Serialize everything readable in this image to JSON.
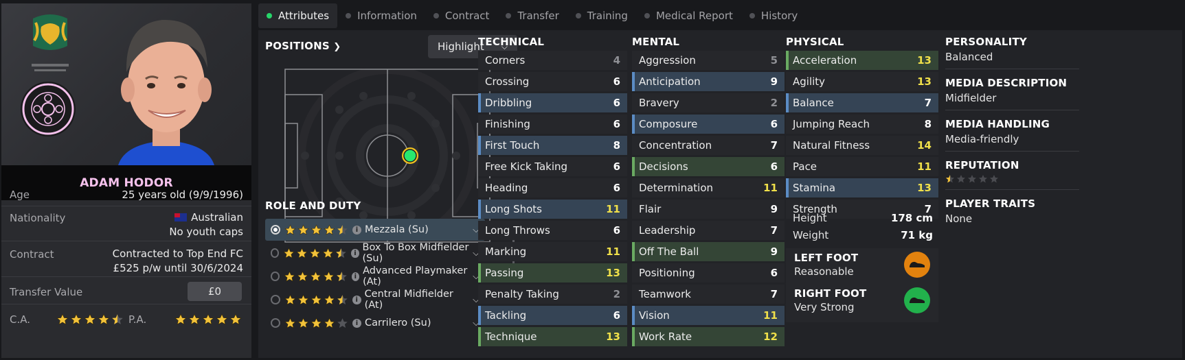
{
  "player": {
    "name": "ADAM HODOR",
    "age_label": "Age",
    "age": "25 years old (9/9/1996)",
    "nationality_label": "Nationality",
    "nationality": "Australian",
    "youth_caps": "No youth caps",
    "contract_label": "Contract",
    "contract_line1": "Contracted to Top End FC",
    "contract_line2": "£525 p/w until 30/6/2024",
    "transfer_label": "Transfer Value",
    "transfer_value": "£0",
    "ca_label": "C.A.",
    "pa_label": "P.A.",
    "ca_stars": 4.5,
    "pa_stars": 5
  },
  "tabs": [
    {
      "label": "Attributes",
      "active": true
    },
    {
      "label": "Information"
    },
    {
      "label": "Contract"
    },
    {
      "label": "Transfer"
    },
    {
      "label": "Training"
    },
    {
      "label": "Medical Report"
    },
    {
      "label": "History"
    }
  ],
  "positions": {
    "title": "POSITIONS",
    "highlight_label": "Highlight"
  },
  "role_duty": {
    "title": "ROLE AND DUTY",
    "roles": [
      {
        "label": "Mezzala (Su)",
        "stars": 4.5,
        "selected": true
      },
      {
        "label": "Box To Box Midfielder (Su)",
        "stars": 4.5
      },
      {
        "label": "Advanced Playmaker (At)",
        "stars": 4.5
      },
      {
        "label": "Central Midfielder (At)",
        "stars": 4.5
      },
      {
        "label": "Carrilero (Su)",
        "stars": 4
      }
    ]
  },
  "technical": {
    "title": "TECHNICAL",
    "rows": [
      {
        "name": "Corners",
        "value": "4",
        "hl": "",
        "tone": "g"
      },
      {
        "name": "Crossing",
        "value": "6",
        "hl": "",
        "tone": "w"
      },
      {
        "name": "Dribbling",
        "value": "6",
        "hl": "blue",
        "tone": "w"
      },
      {
        "name": "Finishing",
        "value": "6",
        "hl": "",
        "tone": "w"
      },
      {
        "name": "First Touch",
        "value": "8",
        "hl": "blue",
        "tone": "w"
      },
      {
        "name": "Free Kick Taking",
        "value": "6",
        "hl": "",
        "tone": "w"
      },
      {
        "name": "Heading",
        "value": "6",
        "hl": "",
        "tone": "w"
      },
      {
        "name": "Long Shots",
        "value": "11",
        "hl": "blue",
        "tone": "y"
      },
      {
        "name": "Long Throws",
        "value": "6",
        "hl": "",
        "tone": "w"
      },
      {
        "name": "Marking",
        "value": "11",
        "hl": "",
        "tone": "y"
      },
      {
        "name": "Passing",
        "value": "13",
        "hl": "green",
        "tone": "y"
      },
      {
        "name": "Penalty Taking",
        "value": "2",
        "hl": "",
        "tone": "g"
      },
      {
        "name": "Tackling",
        "value": "6",
        "hl": "blue",
        "tone": "w"
      },
      {
        "name": "Technique",
        "value": "13",
        "hl": "green",
        "tone": "y"
      }
    ]
  },
  "mental": {
    "title": "MENTAL",
    "rows": [
      {
        "name": "Aggression",
        "value": "5",
        "hl": "",
        "tone": "g"
      },
      {
        "name": "Anticipation",
        "value": "9",
        "hl": "blue",
        "tone": "w"
      },
      {
        "name": "Bravery",
        "value": "2",
        "hl": "",
        "tone": "g"
      },
      {
        "name": "Composure",
        "value": "6",
        "hl": "blue",
        "tone": "w"
      },
      {
        "name": "Concentration",
        "value": "7",
        "hl": "",
        "tone": "w"
      },
      {
        "name": "Decisions",
        "value": "6",
        "hl": "green",
        "tone": "w"
      },
      {
        "name": "Determination",
        "value": "11",
        "hl": "",
        "tone": "y"
      },
      {
        "name": "Flair",
        "value": "9",
        "hl": "",
        "tone": "w"
      },
      {
        "name": "Leadership",
        "value": "7",
        "hl": "",
        "tone": "w"
      },
      {
        "name": "Off The Ball",
        "value": "9",
        "hl": "green",
        "tone": "w"
      },
      {
        "name": "Positioning",
        "value": "6",
        "hl": "",
        "tone": "w"
      },
      {
        "name": "Teamwork",
        "value": "7",
        "hl": "",
        "tone": "w"
      },
      {
        "name": "Vision",
        "value": "11",
        "hl": "blue",
        "tone": "y"
      },
      {
        "name": "Work Rate",
        "value": "12",
        "hl": "green",
        "tone": "y"
      }
    ]
  },
  "physical": {
    "title": "PHYSICAL",
    "rows": [
      {
        "name": "Acceleration",
        "value": "13",
        "hl": "green",
        "tone": "y"
      },
      {
        "name": "Agility",
        "value": "13",
        "hl": "",
        "tone": "y"
      },
      {
        "name": "Balance",
        "value": "7",
        "hl": "blue",
        "tone": "w"
      },
      {
        "name": "Jumping Reach",
        "value": "8",
        "hl": "",
        "tone": "w"
      },
      {
        "name": "Natural Fitness",
        "value": "14",
        "hl": "",
        "tone": "y"
      },
      {
        "name": "Pace",
        "value": "11",
        "hl": "",
        "tone": "y"
      },
      {
        "name": "Stamina",
        "value": "13",
        "hl": "blue",
        "tone": "y"
      },
      {
        "name": "Strength",
        "value": "7",
        "hl": "",
        "tone": "w"
      }
    ],
    "height_label": "Height",
    "height": "178 cm",
    "weight_label": "Weight",
    "weight": "71 kg",
    "left_foot_label": "LEFT FOOT",
    "left_foot": "Reasonable",
    "right_foot_label": "RIGHT FOOT",
    "right_foot": "Very Strong"
  },
  "profile": {
    "personality_label": "PERSONALITY",
    "personality": "Balanced",
    "media_desc_label": "MEDIA DESCRIPTION",
    "media_desc": "Midfielder",
    "media_handling_label": "MEDIA HANDLING",
    "media_handling": "Media-friendly",
    "reputation_label": "REPUTATION",
    "reputation_stars": 0.5,
    "traits_label": "PLAYER TRAITS",
    "traits": "None"
  },
  "colors": {
    "accent": "#27d66a",
    "star": "#f2c23a",
    "name": "#f5c1ec"
  }
}
